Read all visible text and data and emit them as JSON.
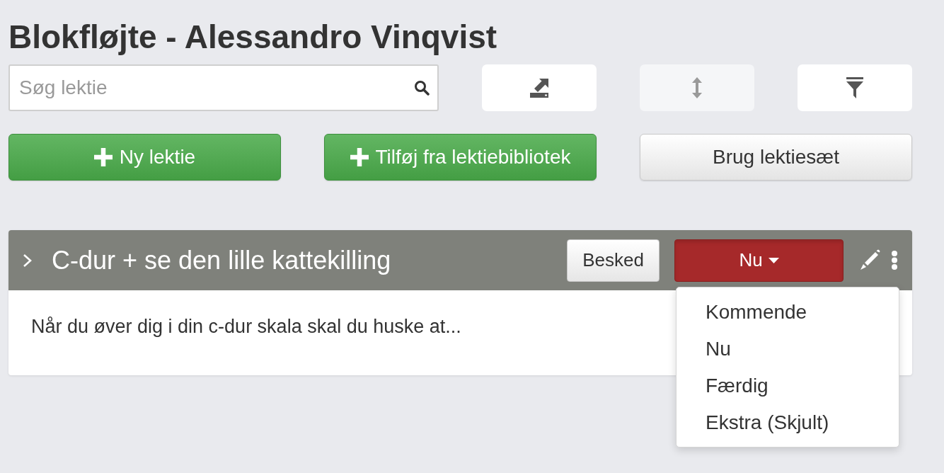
{
  "page": {
    "title": "Blokfløjte - Alessandro Vinqvist"
  },
  "toolbar": {
    "search": {
      "placeholder": "Søg lektie"
    },
    "icon_buttons": [
      {
        "kind": "export",
        "disabled": false
      },
      {
        "kind": "sort",
        "disabled": true
      },
      {
        "kind": "filter",
        "disabled": false
      }
    ]
  },
  "actions": [
    {
      "label": "Ny lektie",
      "kind": "primary"
    },
    {
      "label": "Tilføj fra lektiebibliotek",
      "kind": "primary"
    },
    {
      "label": "Brug lektiesæt",
      "kind": "default"
    }
  ],
  "lessons": [
    {
      "title": "C-dur + se den lille kattekilling",
      "message_button": "Besked",
      "status": {
        "label": "Nu",
        "open": true,
        "options": [
          "Kommende",
          "Nu",
          "Færdig",
          "Ekstra (Skjult)"
        ]
      },
      "description": "Når du øver dig i din c-dur skala skal du huske at..."
    }
  ]
}
